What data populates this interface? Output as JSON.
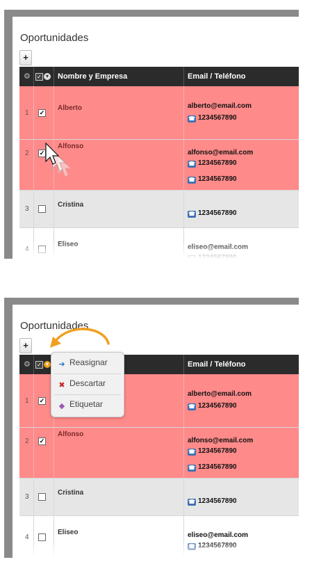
{
  "colors": {
    "row_highlight": "#ff8a8a",
    "row_plain": "#e6e6e6",
    "header_bg": "#2b2b2b",
    "arrow": "#f0a020"
  },
  "panel_title": "Oportunidades",
  "add_button": "+",
  "icons": {
    "settings": "gear-icon",
    "select_all": "checkbox-icon",
    "options": "chevron-down-icon",
    "phone": "phone-icon"
  },
  "table": {
    "col_name": "Nombre y Empresa",
    "col_contact": "Email / Teléfono",
    "rows": [
      {
        "num": "1",
        "checked": true,
        "name": "Alberto",
        "email": "alberto@email.com",
        "phones": [
          "1234567890"
        ]
      },
      {
        "num": "2",
        "checked": true,
        "name": "Alfonso",
        "email": "alfonso@email.com",
        "phones": [
          "1234567890",
          "1234567890"
        ]
      },
      {
        "num": "3",
        "checked": false,
        "name": "Cristina",
        "email": "",
        "phones": [
          "1234567890"
        ]
      },
      {
        "num": "4",
        "checked": false,
        "name": "Eliseo",
        "email": "eliseo@email.com",
        "phones": [
          "1234567890"
        ]
      }
    ]
  },
  "menu": [
    {
      "label": "Reasignar",
      "icon": "arrow-right-icon"
    },
    {
      "label": "Descartar",
      "icon": "discard-icon"
    },
    {
      "label": "Etiquetar",
      "icon": "tag-icon"
    }
  ]
}
